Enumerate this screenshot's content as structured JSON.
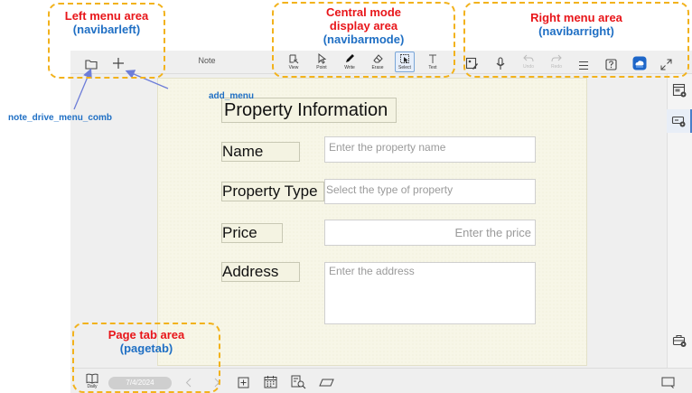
{
  "navbar": {
    "title": "Note",
    "modes": [
      {
        "label": "View",
        "icon": "view-icon"
      },
      {
        "label": "Point",
        "icon": "pointer-icon"
      },
      {
        "label": "Write",
        "icon": "pen-icon"
      },
      {
        "label": "Erase",
        "icon": "eraser-icon"
      },
      {
        "label": "Select",
        "icon": "lasso-select-icon",
        "active": true
      },
      {
        "label": "Text",
        "icon": "text-icon"
      }
    ],
    "right": {
      "undo_label": "Undo",
      "redo_label": "Redo"
    }
  },
  "form": {
    "title": "Property Information",
    "fields": [
      {
        "label": "Name",
        "placeholder": "Enter the property name"
      },
      {
        "label": "Property Type",
        "placeholder": "Select the type of property"
      },
      {
        "label": "Price",
        "placeholder": "Enter the price"
      },
      {
        "label": "Address",
        "placeholder": "Enter the address"
      }
    ]
  },
  "pagetab": {
    "daily_label": "Daily",
    "date": "7/4/2024"
  },
  "annotations": {
    "left_menu": {
      "title": "Left menu area",
      "code": "(navibarleft)"
    },
    "central_mode": {
      "title_line1": "Central mode",
      "title_line2": "display area",
      "code": "(navibarmode)"
    },
    "right_menu": {
      "title": "Right menu area",
      "code": "(navibarright)"
    },
    "page_tab": {
      "title": "Page tab area",
      "code": "(pagetab)"
    },
    "add_menu": "add_menu",
    "note_drive": "note_drive_menu_comb"
  },
  "colors": {
    "annotation_title": "#e8161a",
    "annotation_code": "#1f6fc4",
    "callout_border": "#f2b21c",
    "page_bg": "#f7f6e7",
    "accent": "#4a7fc9"
  }
}
